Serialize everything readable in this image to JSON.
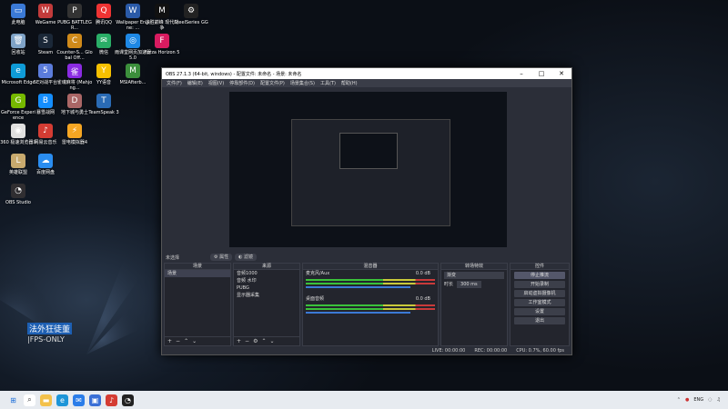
{
  "desktop": {
    "icons": [
      {
        "label": "此电脑",
        "color": "#3b7ad6",
        "glyph": "▭"
      },
      {
        "label": "WeGame",
        "color": "#c23b3b",
        "glyph": "W"
      },
      {
        "label": "PUBG BATTLEGR...",
        "color": "#333",
        "glyph": "P"
      },
      {
        "label": "腾讯QQ",
        "color": "#e33",
        "glyph": "Q"
      },
      {
        "label": "Wallpaper Engine: ...",
        "color": "#2a5aa8",
        "glyph": "W"
      },
      {
        "label": "决胜巅峰 现代战争",
        "color": "#111",
        "glyph": "M"
      },
      {
        "label": "SteelSeries GG",
        "color": "#222",
        "glyph": "⚙"
      },
      {
        "label": "回收站",
        "color": "#7fa3c7",
        "glyph": "🗑"
      },
      {
        "label": "Steam",
        "color": "#1b2838",
        "glyph": "S"
      },
      {
        "label": "Counter-S... Global Off...",
        "color": "#d08a1a",
        "glyph": "C"
      },
      {
        "label": "微信",
        "color": "#2aae67",
        "glyph": "✉"
      },
      {
        "label": "雨课堂网页加速器5.0",
        "color": "#1e88e5",
        "glyph": "◎"
      },
      {
        "label": "Forza Horizon 5",
        "color": "#d81b60",
        "glyph": "F"
      },
      {
        "label": "Microsoft Edge",
        "color": "#0f9bd7",
        "glyph": "e"
      },
      {
        "label": "5E对战平台",
        "color": "#5b7cdb",
        "glyph": "5"
      },
      {
        "label": "雀魂麻将 (Mahjong...",
        "color": "#8a2be2",
        "glyph": "雀"
      },
      {
        "label": "YY语音",
        "color": "#f6c000",
        "glyph": "Y"
      },
      {
        "label": "MSIAfterb...",
        "color": "#3c8f3c",
        "glyph": "M"
      },
      {
        "label": "GeForce Experience",
        "color": "#76b900",
        "glyph": "G"
      },
      {
        "label": "暴雪战网",
        "color": "#148eff",
        "glyph": "B"
      },
      {
        "label": "地下城与勇士",
        "color": "#a66",
        "glyph": "D"
      },
      {
        "label": "TeamSpeak 3",
        "color": "#2a6bb5",
        "glyph": "T"
      },
      {
        "label": "360 极速浏览器X",
        "color": "#e0e0e0",
        "glyph": "◉"
      },
      {
        "label": "网易云音乐",
        "color": "#d43c33",
        "glyph": "♪"
      },
      {
        "label": "雷电模拟器4",
        "color": "#f5a623",
        "glyph": "⚡"
      },
      {
        "label": "英雄联盟",
        "color": "#c8aa6e",
        "glyph": "L"
      },
      {
        "label": "百度网盘",
        "color": "#2a8df0",
        "glyph": "☁"
      },
      {
        "label": "OBS Studio",
        "color": "#302e31",
        "glyph": "◔"
      }
    ]
  },
  "obs": {
    "title": "OBS 27.1.3 (64-bit, windows) - 配置文件: 未命名 - 场景: 未命名",
    "menu": [
      "文件(F)",
      "编辑(E)",
      "视图(V)",
      "停靠部件(D)",
      "配置文件(P)",
      "场景集合(S)",
      "工具(T)",
      "帮助(H)"
    ],
    "no_source_label": "未选择",
    "props_btn": "⚙ 属性",
    "filters_btn": "◐ 滤镜",
    "scenes": {
      "header": "场景",
      "items": [
        "场景"
      ]
    },
    "sources": {
      "header": "来源",
      "items": [
        "音频1000",
        "音频 水印",
        "PUBG",
        "显示器采集"
      ]
    },
    "mixer": {
      "header": "混音器",
      "tracks": [
        {
          "name": "麦克风/Aux",
          "db": "0.0 dB"
        },
        {
          "name": "桌面音频",
          "db": "0.0 dB"
        }
      ]
    },
    "transitions": {
      "header": "转场特效",
      "type": "渐变",
      "duration_label": "时长",
      "duration": "300 ms"
    },
    "controls": {
      "header": "控件",
      "buttons": [
        "停止推流",
        "开始录制",
        "启动虚拟摄像机",
        "工作室模式",
        "设置",
        "退出"
      ]
    },
    "status": {
      "live": "LIVE: 00:00:00",
      "rec": "REC: 00:00:00",
      "cpu": "CPU: 0.7%, 60.00 fps"
    }
  },
  "watermark": {
    "text1": "法外狂徒董",
    "text2": "|FPS-ONLY"
  },
  "taskbar": {
    "lang": "ENG",
    "icons": [
      "windows-logo",
      "search",
      "file-explorer",
      "edge",
      "mail",
      "store",
      "netease",
      "obs"
    ]
  }
}
